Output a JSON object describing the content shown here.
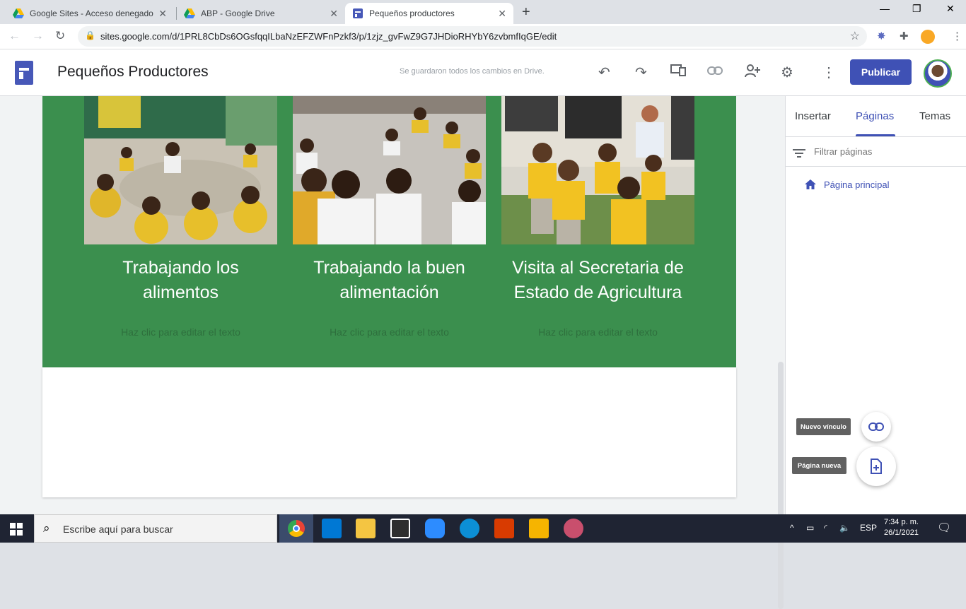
{
  "browser": {
    "tabs": [
      {
        "title": "Google Sites - Acceso denegado",
        "active": false
      },
      {
        "title": "ABP - Google Drive",
        "active": false
      },
      {
        "title": "Pequeños productores",
        "active": true
      }
    ],
    "url": "sites.google.com/d/1PRL8CbDs6OGsfqqILbaNzEFZWFnPzkf3/p/1zjz_gvFwZ9G7JHDioRHYbY6zvbmfIqGE/edit"
  },
  "sites": {
    "title": "Pequeños Productores",
    "save_status": "Se guardaron todos los cambios en Drive.",
    "publish_label": "Publicar"
  },
  "cards": [
    {
      "title_line1": "Trabajando los",
      "title_line2": "alimentos",
      "text": "Haz clic para editar el texto"
    },
    {
      "title_line1": "Trabajando la buen",
      "title_line2": "alimentación",
      "text": "Haz clic para editar el texto"
    },
    {
      "title_line1": "Visita al Secretaria de",
      "title_line2": "Estado de Agricultura",
      "text": "Haz clic para editar el texto"
    }
  ],
  "panel": {
    "tabs": [
      "Insertar",
      "Páginas",
      "Temas"
    ],
    "active_tab": "Páginas",
    "filter_placeholder": "Filtrar páginas",
    "pages": [
      {
        "label": "Página principal"
      }
    ],
    "fab_link_tooltip": "Nuevo vínculo",
    "fab_page_tooltip": "Página nueva"
  },
  "taskbar": {
    "search_placeholder": "Escribe aquí para buscar",
    "language": "ESP",
    "time": "7:34 p. m.",
    "date": "26/1/2021"
  },
  "colors": {
    "section_green": "#3b8f4e",
    "accent": "#3f51b5"
  }
}
